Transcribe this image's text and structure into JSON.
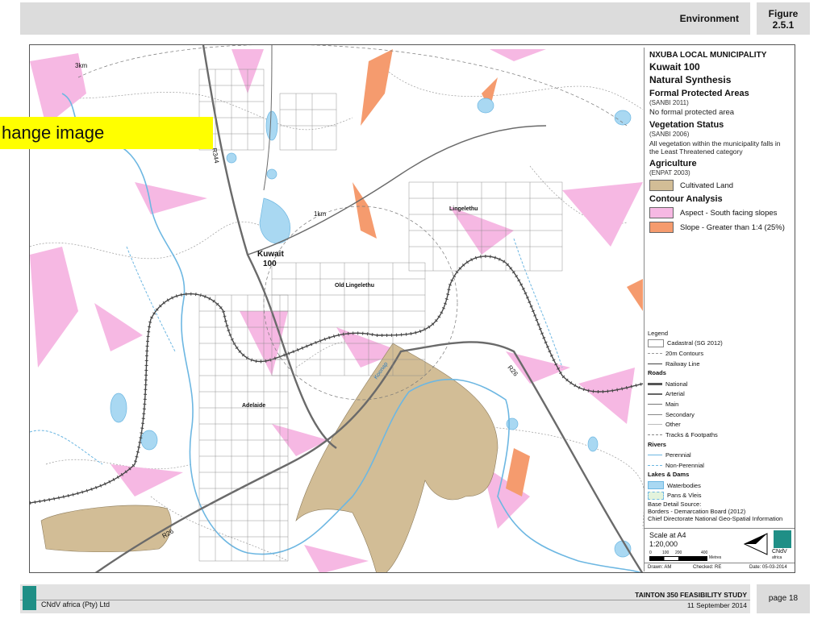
{
  "header": {
    "title": "Environment",
    "figure_line1": "Figure",
    "figure_line2": "2.5.1"
  },
  "overlay": {
    "change_image": "hange image"
  },
  "map_labels": {
    "km3": "3km",
    "km1": "1km",
    "r344": "R344",
    "r26a": "R26",
    "r26b": "R26",
    "kuwait1": "Kuwait",
    "kuwait2": "100",
    "old_lingelethu": "Old Lingelethu",
    "lingelethu": "Lingelethu",
    "adelaide": "Adelaide",
    "koonap": "Koonap"
  },
  "panel": {
    "municipality": "NXUBA LOCAL MUNICIPALITY",
    "area": "Kuwait 100",
    "title": "Natural Synthesis",
    "formal_head": "Formal Protected Areas",
    "formal_src": "(SANBI 2011)",
    "formal_text": "No formal protected area",
    "veg_head": "Vegetation Status",
    "veg_src": "(SANBI 2006)",
    "veg_text": "All vegetation within the municipality falls in the Least Threatened category",
    "agri_head": "Agriculture",
    "agri_src": "(ENPAT 2003)",
    "agri_item": "Cultivated Land",
    "contour_head": "Contour Analysis",
    "contour_item1": "Aspect - South facing slopes",
    "contour_item2": "Slope - Greater than 1:4 (25%)",
    "legend_title": "Legend",
    "lg_cadastral": "Cadastral (SG 2012)",
    "lg_contours": "20m Contours",
    "lg_railway": "Railway Line",
    "lg_roads": "Roads",
    "lg_national": "National",
    "lg_arterial": "Arterial",
    "lg_main": "Main",
    "lg_secondary": "Secondary",
    "lg_other": "Other",
    "lg_tracks": "Tracks & Footpaths",
    "lg_rivers": "Rivers",
    "lg_perennial": "Perennial",
    "lg_nonperennial": "Non-Perennial",
    "lg_lakes": "Lakes & Dams",
    "lg_waterbodies": "Waterbodies",
    "lg_pans": "Pans & Vleis",
    "base_head": "Base Detail Source:",
    "base_line1": "Borders - Demarcation Board (2012)",
    "base_line2": "Chief Directorate National Geo-Spatial Information",
    "scale_line1": "Scale at A4",
    "scale_line2": "1:20,000",
    "scale_t0": "0",
    "scale_t1": "100",
    "scale_t2": "200",
    "scale_t3": "400",
    "scale_unit": "Metres",
    "logo_text": "CNdV",
    "logo_sub": "africa",
    "drawn": "Drawn: AM",
    "checked": "Checked: RE",
    "date": "Date: 05-03-2014"
  },
  "footer": {
    "company": "CNdV africa (Pty) Ltd",
    "study": "TAINTON 350 FEASIBILITY STUDY",
    "date": "11 September 2014",
    "page": "page 18"
  },
  "colors": {
    "cultivated": "#d2bd96",
    "aspect": "#f6b8e3",
    "slope": "#f59b6e",
    "water": "#a9d8f2",
    "river": "#6db7e2",
    "road": "#6a6a6a",
    "cnvd": "#1f8f86"
  }
}
